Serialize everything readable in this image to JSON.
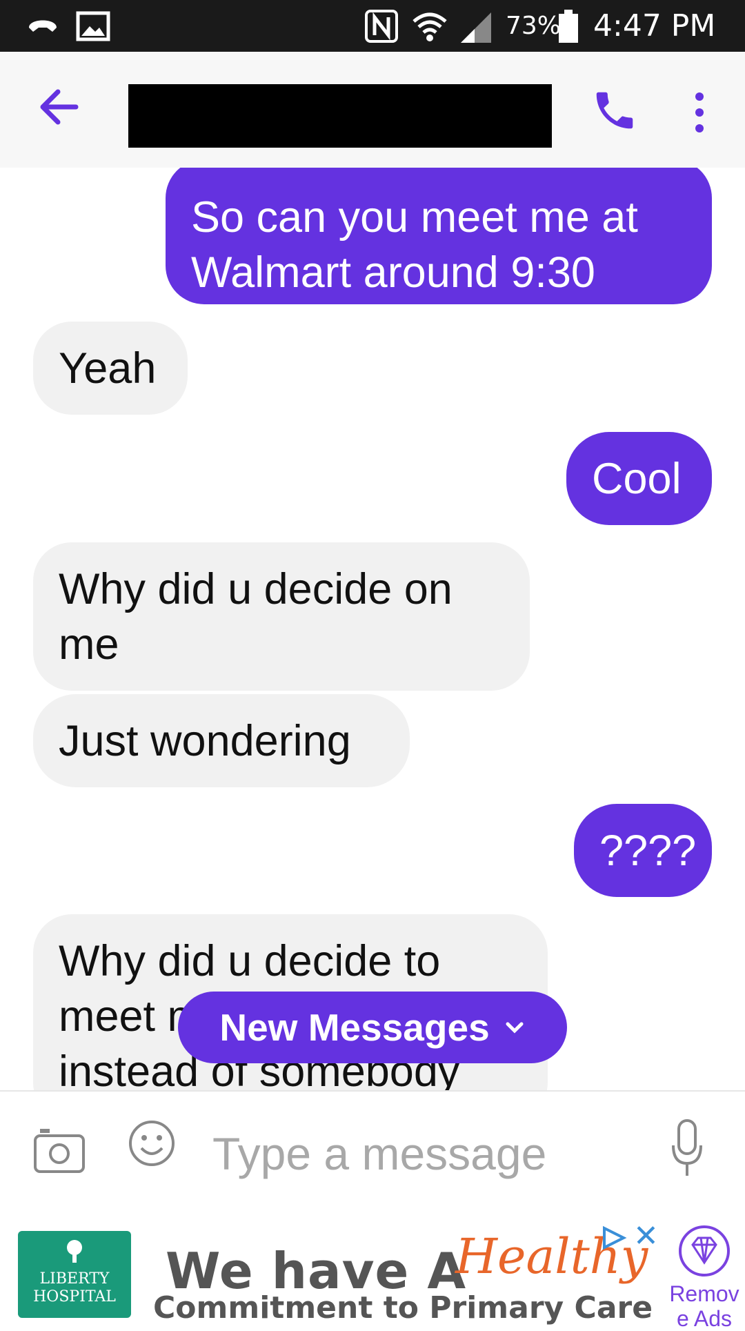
{
  "status_bar": {
    "battery_percent": "73%",
    "time": "4:47 PM",
    "icons": [
      "voicemail-icon",
      "image-icon",
      "nfc-icon",
      "wifi-icon",
      "signal-icon",
      "battery-icon"
    ]
  },
  "header": {
    "back_icon": "arrow-left-icon",
    "call_icon": "phone-icon",
    "more_icon": "more-vertical-icon",
    "accent_color": "#6432e0"
  },
  "messages": [
    {
      "direction": "outgoing",
      "text": "So can you meet me at\nWalmart around 9:30"
    },
    {
      "direction": "incoming",
      "text": "Yeah"
    },
    {
      "direction": "outgoing",
      "text": "Cool"
    },
    {
      "direction": "incoming",
      "text": "Why did u decide on\nme"
    },
    {
      "direction": "incoming",
      "text": "Just wondering"
    },
    {
      "direction": "outgoing",
      "text": "????"
    },
    {
      "direction": "incoming",
      "text": "Why did u decide to\nmeet me\ninstead of somebody"
    }
  ],
  "new_messages_button": {
    "label": "New Messages",
    "chevron": "˅"
  },
  "composer": {
    "placeholder": "Type a message",
    "camera_icon": "camera-icon",
    "emoji_icon": "emoji-icon",
    "mic_icon": "microphone-icon"
  },
  "ad": {
    "logo_line1": "LIBERTY",
    "logo_line2": "HOSPITAL",
    "headline": "We have A",
    "headline_script": "Healthy",
    "subline": "Commitment to Primary Care",
    "remove_label_line1": "Remov",
    "remove_label_line2": "e Ads",
    "remove_icon": "diamond-icon",
    "close_glyph": "✕"
  }
}
